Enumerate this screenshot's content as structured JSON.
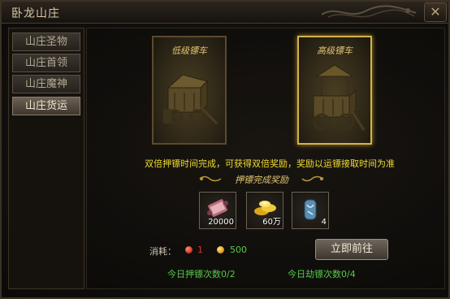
{
  "window": {
    "title": "卧龙山庄"
  },
  "sidebar": {
    "items": [
      {
        "label": "山庄圣物"
      },
      {
        "label": "山庄首领"
      },
      {
        "label": "山庄魔神"
      },
      {
        "label": "山庄货运",
        "active": true
      }
    ]
  },
  "carts": {
    "low": {
      "title": "低级镖车"
    },
    "high": {
      "title": "高级镖车",
      "selected": true
    }
  },
  "info_text": "双倍押镖时间完成，可获得双倍奖励，奖励以运镖接取时间为准",
  "rewards": {
    "header": "押镖完成奖励",
    "items": [
      {
        "icon": "scroll-icon",
        "count": "20000"
      },
      {
        "icon": "gold-ingot-icon",
        "count": "60万"
      },
      {
        "icon": "blue-gem-icon",
        "count": "4"
      }
    ]
  },
  "cost": {
    "label": "消耗：",
    "red_value": "1",
    "gold_value": "500",
    "red_color": "#d43a2a",
    "gold_color": "#e0a020"
  },
  "go_button": {
    "label": "立即前往"
  },
  "counts": {
    "escort": "今日押镖次数0/2",
    "rob": "今日劫镖次数0/4"
  },
  "colors": {
    "info": "#f2dd34",
    "count": "#58c94c",
    "selected_border": "#d3b24c"
  }
}
